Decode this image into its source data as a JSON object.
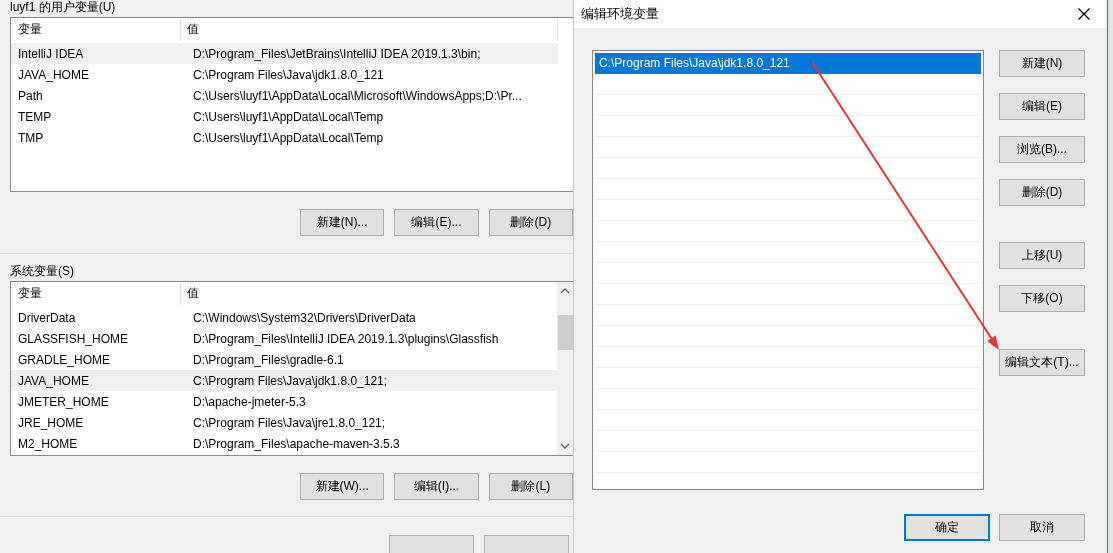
{
  "user_vars": {
    "label": "luyf1 的用户变量(U)",
    "columns": [
      "变量",
      "值"
    ],
    "scrollbar": false,
    "rows": [
      {
        "name": "IntelliJ IDEA",
        "value": "D:\\Program_Files\\JetBrains\\IntelliJ IDEA 2019.1.3\\bin;",
        "selected": true
      },
      {
        "name": "JAVA_HOME",
        "value": "C:\\Program Files\\Java\\jdk1.8.0_121",
        "selected": false
      },
      {
        "name": "Path",
        "value": "C:\\Users\\luyf1\\AppData\\Local\\Microsoft\\WindowsApps;D:\\Pr...",
        "selected": false
      },
      {
        "name": "TEMP",
        "value": "C:\\Users\\luyf1\\AppData\\Local\\Temp",
        "selected": false
      },
      {
        "name": "TMP",
        "value": "C:\\Users\\luyf1\\AppData\\Local\\Temp",
        "selected": false
      }
    ],
    "buttons": [
      "新建(N)...",
      "编辑(E)...",
      "删除(D)"
    ]
  },
  "system_vars": {
    "label": "系统变量(S)",
    "columns": [
      "变量",
      "值"
    ],
    "scrollbar": true,
    "rows": [
      {
        "name": "DriverData",
        "value": "C:\\Windows\\System32\\Drivers\\DriverData",
        "selected": false
      },
      {
        "name": "GLASSFISH_HOME",
        "value": "D:\\Program_Files\\IntelliJ IDEA 2019.1.3\\plugins\\Glassfish",
        "selected": false
      },
      {
        "name": "GRADLE_HOME",
        "value": "D:\\Program_Files\\gradle-6.1",
        "selected": false
      },
      {
        "name": "JAVA_HOME",
        "value": "C:\\Program Files\\Java\\jdk1.8.0_121;",
        "selected": true
      },
      {
        "name": "JMETER_HOME",
        "value": "D:\\apache-jmeter-5.3",
        "selected": false
      },
      {
        "name": "JRE_HOME",
        "value": "C:\\Program Files\\Java\\jre1.8.0_121;",
        "selected": false
      },
      {
        "name": "M2_HOME",
        "value": "D:\\Program_Files\\apache-maven-3.5.3",
        "selected": false
      }
    ],
    "buttons": [
      "新建(W)...",
      "编辑(I)...",
      "删除(L)"
    ]
  },
  "dialog": {
    "title": "编辑环境变量",
    "entries": [
      {
        "text": "C:\\Program Files\\Java\\jdk1.8.0_121",
        "selected": true
      }
    ],
    "side_buttons": [
      [
        "新建(N)",
        "编辑(E)",
        "浏览(B)...",
        "删除(D)"
      ],
      [
        "上移(U)",
        "下移(O)"
      ],
      [
        "编辑文本(T)..."
      ]
    ],
    "footer_buttons": [
      {
        "label": "确定",
        "default": true
      },
      {
        "label": "取消",
        "default": false
      }
    ]
  }
}
